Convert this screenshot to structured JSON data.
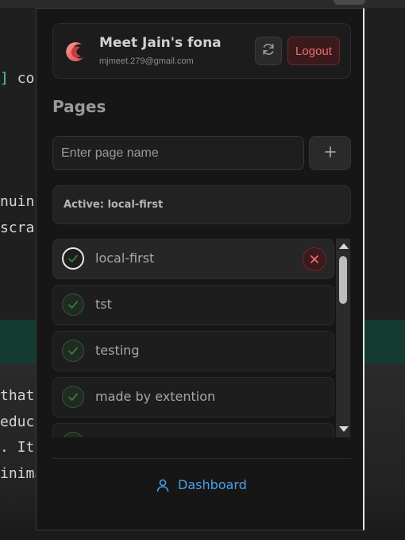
{
  "background_editor": {
    "lines": [
      {
        "bracket": "]",
        "text": " co"
      },
      {
        "bracket": "",
        "text": "nuin"
      },
      {
        "bracket": "",
        "text": "scra"
      },
      {
        "bracket": "",
        "text": "that"
      },
      {
        "bracket": "",
        "text": "educ"
      },
      {
        "bracket": "",
        "text": ". It"
      },
      {
        "bracket": "",
        "text": "inima"
      }
    ]
  },
  "profile": {
    "name": "Meet Jain's fona",
    "email": "mjmeet.279@gmail.com",
    "logo_icon": "crescent-logo-icon",
    "refresh_icon": "refresh-icon",
    "logout_label": "Logout"
  },
  "pages": {
    "heading": "Pages",
    "input_placeholder": "Enter page name",
    "input_value": "",
    "add_icon": "plus-icon",
    "active_text": "Active: local-first",
    "items": [
      {
        "label": "local-first",
        "active": true
      },
      {
        "label": "tst",
        "active": false
      },
      {
        "label": "testing",
        "active": false
      },
      {
        "label": "made by extention",
        "active": false
      },
      {
        "label": "",
        "active": false
      }
    ]
  },
  "footer": {
    "dashboard_label": "Dashboard",
    "dashboard_icon": "user-icon"
  },
  "colors": {
    "accent_red": "#f06b6b",
    "link_blue": "#4a9fe8",
    "check_green": "#3a7a44",
    "panel_bg": "#161616"
  }
}
